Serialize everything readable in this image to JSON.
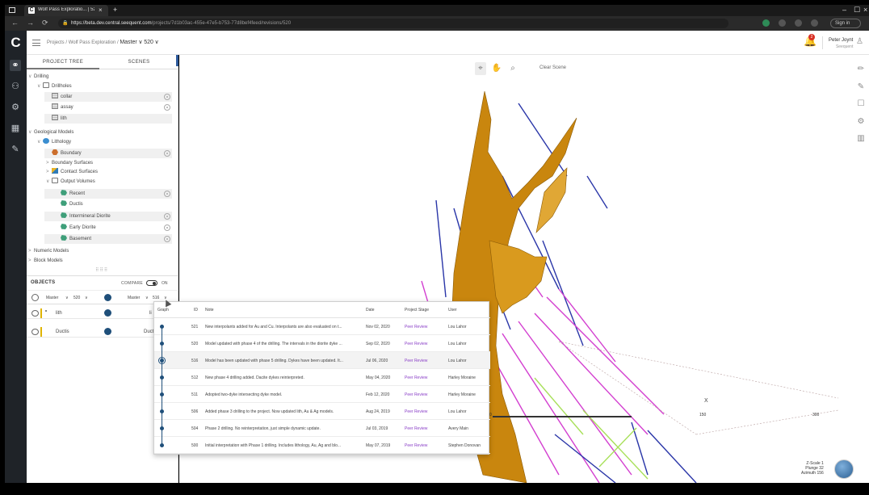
{
  "browser": {
    "tab_title": "Wolf Pass Exploratio... | 520",
    "favicon_letter": "C",
    "tab_close": "×",
    "new_tab": "+",
    "url_host": "https://beta.dev.central.seequent.com",
    "url_path": "/projects/7d1b03ac-455e-47e5-b753-77d8bef4feed/revisions/520",
    "back": "←",
    "forward": "→",
    "reload": "⟳",
    "sign_in": "Sign in",
    "min": "–",
    "max": "☐",
    "close": "×"
  },
  "header": {
    "logo": "C",
    "breadcrumb": [
      "Projects",
      "Wolf Pass Exploration",
      "Master",
      "520"
    ],
    "separator": "/",
    "notification_count": "2",
    "user_name": "Peter Joynt",
    "user_org": "Seequent"
  },
  "rail": {
    "items": [
      {
        "name": "rail-hierarchy",
        "icon": "⚭"
      },
      {
        "name": "rail-users",
        "icon": "⚇"
      },
      {
        "name": "rail-settings",
        "icon": "⚙"
      },
      {
        "name": "rail-calendar",
        "icon": "▦"
      },
      {
        "name": "rail-tools",
        "icon": "✎"
      }
    ]
  },
  "panel": {
    "tabs": [
      "PROJECT TREE",
      "SCENES"
    ],
    "tree": [
      {
        "label": "Drilling",
        "depth": 0,
        "caret": "∨",
        "icon": "",
        "eye": false,
        "shaded": false
      },
      {
        "label": "Drillholes",
        "depth": 1,
        "caret": "∨",
        "icon": "folder",
        "eye": false,
        "shaded": false
      },
      {
        "label": "collar",
        "depth": 2,
        "caret": "",
        "icon": "table",
        "eye": true,
        "shaded": true
      },
      {
        "label": "assay",
        "depth": 2,
        "caret": "",
        "icon": "table",
        "eye": true,
        "shaded": false
      },
      {
        "label": "lith",
        "depth": 2,
        "caret": "",
        "icon": "table",
        "eye": false,
        "shaded": true
      },
      {
        "label": "Geological Models",
        "depth": 0,
        "caret": "∨",
        "icon": "",
        "eye": false,
        "shaded": false
      },
      {
        "label": "Lithology",
        "depth": 1,
        "caret": "∨",
        "icon": "globe",
        "eye": false,
        "shaded": false
      },
      {
        "label": "Boundary",
        "depth": 2,
        "caret": "",
        "icon": "hex",
        "eye": true,
        "shaded": true
      },
      {
        "label": "Boundary Surfaces",
        "depth": 2,
        "caret": ">",
        "icon": "",
        "eye": false,
        "shaded": false
      },
      {
        "label": "Contact Surfaces",
        "depth": 2,
        "caret": ">",
        "icon": "surf",
        "eye": false,
        "shaded": false
      },
      {
        "label": "Output Volumes",
        "depth": 2,
        "caret": "∨",
        "icon": "folder",
        "eye": false,
        "shaded": false
      },
      {
        "label": "Recent",
        "depth": 3,
        "caret": "",
        "icon": "shape",
        "eye": true,
        "shaded": true
      },
      {
        "label": "Ductis",
        "depth": 3,
        "caret": "",
        "icon": "shape",
        "eye": false,
        "shaded": false
      },
      {
        "label": "Intermineral Diorite",
        "depth": 3,
        "caret": "",
        "icon": "shape",
        "eye": true,
        "shaded": true
      },
      {
        "label": "Early Diorite",
        "depth": 3,
        "caret": "",
        "icon": "shape",
        "eye": true,
        "shaded": false
      },
      {
        "label": "Basement",
        "depth": 3,
        "caret": "",
        "icon": "shape",
        "eye": true,
        "shaded": true
      },
      {
        "label": "Numeric Models",
        "depth": 0,
        "caret": ">",
        "icon": "",
        "eye": false,
        "shaded": false
      },
      {
        "label": "Block Models",
        "depth": 0,
        "caret": ">",
        "icon": "",
        "eye": false,
        "shaded": false
      }
    ],
    "grip": "⠿⠿⠿",
    "objects": {
      "title": "OBJECTS",
      "compare_label": "COMPARE",
      "on_label": "ON",
      "left_branch": "Master",
      "left_version": "520",
      "right_branch": "Master",
      "right_version": "516",
      "rows": [
        {
          "label": "lith",
          "right_text": "li",
          "icon": "table"
        },
        {
          "label": "Ductis",
          "right_text": "Duct",
          "icon": "shape"
        }
      ]
    }
  },
  "viewport": {
    "clear_scene": "Clear Scene",
    "tools": [
      {
        "name": "select-tool",
        "icon": "⌖",
        "active": true
      },
      {
        "name": "pan-tool",
        "icon": "✋",
        "active": false
      },
      {
        "name": "zoom-tool",
        "icon": "⌕",
        "active": false
      }
    ],
    "right_tools": [
      "✏",
      "✎",
      "☐",
      "⚙",
      "▥"
    ],
    "scale": {
      "start": "0",
      "mid": "150",
      "end": "300"
    },
    "z_scale": {
      "label": "Z-Scale",
      "z": "1",
      "plunge_label": "Plunge",
      "plunge": "32",
      "azimuth_label": "Azimuth",
      "azimuth": "156"
    },
    "axis_label": "X"
  },
  "versions": {
    "headers": {
      "graph": "Graph",
      "id": "ID",
      "note": "Note",
      "date": "Date",
      "stage": "Project Stage",
      "user": "User"
    },
    "rows": [
      {
        "id": "521",
        "note": "New interpolants added for Au and Cu. Interpolants are also evaluated on t...",
        "date": "Nov 02, 2020",
        "stage": "Peer Review",
        "user": "Lou Lahor",
        "selected": false
      },
      {
        "id": "520",
        "note": "Model updated with phase 4 of the drilling. The intervals in the diorite dyke ...",
        "date": "Sep 02, 2020",
        "stage": "Peer Review",
        "user": "Lou Lahor",
        "selected": false
      },
      {
        "id": "516",
        "note": "Model has been updated with phase 5 drilling. Dykes have been updated. It...",
        "date": "Jul 06, 2020",
        "stage": "Peer Review",
        "user": "Lou Lahor",
        "selected": true
      },
      {
        "id": "512",
        "note": "New phase 4 drilling added. Dacite dykes reinterpreted.",
        "date": "May 04, 2020",
        "stage": "Peer Review",
        "user": "Harley Moraine",
        "selected": false
      },
      {
        "id": "511",
        "note": "Adopted two-dyke intersecting dyke model.",
        "date": "Feb 12, 2020",
        "stage": "Peer Review",
        "user": "Harley Moraine",
        "selected": false
      },
      {
        "id": "506",
        "note": "Added phase 3 drilling to the project. Now updated lith, Au & Ag models.",
        "date": "Aug 24, 2019",
        "stage": "Peer Review",
        "user": "Lou Lahor",
        "selected": false
      },
      {
        "id": "504",
        "note": "Phase 2 drilling. No reinterpretation, just simple dynamic update.",
        "date": "Jul 03, 2019",
        "stage": "Peer Review",
        "user": "Avery Main",
        "selected": false
      },
      {
        "id": "500",
        "note": "Initial interpretation with Phase 1 drilling. Includes lithology, Au, Ag and blo...",
        "date": "May 07, 2019",
        "stage": "Peer Review",
        "user": "Stephen Donovan",
        "selected": false
      }
    ]
  },
  "colors": {
    "accent": "#1f4f7a",
    "stage": "#8a3fc7",
    "orebody": "#c9860e",
    "dark_rail": "#1f2328"
  }
}
